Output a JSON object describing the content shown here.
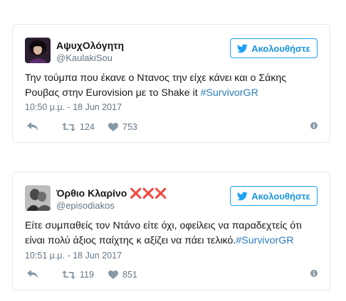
{
  "tweets": [
    {
      "display_name": "ΑψυχΟλόγητη",
      "handle": "@KaulakiSou",
      "follow_label": "Ακολουθήστε",
      "text": "Την τούμπα που έκανε ο Ντανος την είχε κάνει και ο Σάκης Ρουβας στην Eurovision με το Shake it ",
      "hashtag": "#SurvivorGR",
      "timestamp": "10:50 μ.μ. - 18 Jun 2017",
      "retweets": "124",
      "likes": "753"
    },
    {
      "display_name": "Όρθιο Κλαρίνο ❌❌❌",
      "handle": "@episodiakos",
      "follow_label": "Ακολουθήστε",
      "text": "Είτε συμπαθείς τον Ντάνο είτε όχι, οφείλεις να παραδεχτείς ότι είναι πολύ άξιος παίχτης κ αξίζει να πάει τελικό.",
      "hashtag": "#SurvivorGR",
      "timestamp": "10:51 μ.μ. - 18 Jun 2017",
      "retweets": "119",
      "likes": "851"
    }
  ],
  "colors": {
    "accent": "#1da1f2",
    "hashtag": "#2b7bb9",
    "muted": "#657786",
    "border": "#e1e8ed"
  },
  "icons": [
    "bird-icon",
    "reply-icon",
    "retweet-icon",
    "heart-icon",
    "info-icon"
  ]
}
